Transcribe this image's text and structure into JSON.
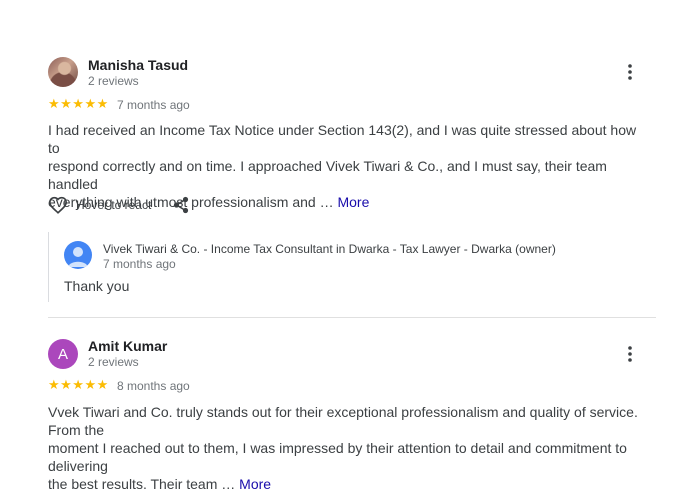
{
  "reviews": [
    {
      "author": "Manisha Tasud",
      "review_count": "2 reviews",
      "avatar": "photo",
      "rating": "★★★★★",
      "date": "7 months ago",
      "text_lines": [
        "I had received an Income Tax Notice under Section 143(2), and I was quite stressed about how to",
        "respond correctly and on time. I approached Vivek Tiwari & Co., and I must say, their team handled",
        "everything with utmost professionalism and … "
      ],
      "more_label": "More",
      "react_label": "Hover to react",
      "reply": {
        "owner": "Vivek Tiwari & Co. - Income Tax Consultant in Dwarka - Tax Lawyer - Dwarka (owner)",
        "date": "7 months ago",
        "text": "Thank you"
      }
    },
    {
      "author": "Amit Kumar",
      "review_count": "2 reviews",
      "avatar_letter": "A",
      "rating": "★★★★★",
      "date": "8 months ago",
      "text_lines": [
        "Vvek Tiwari and Co. truly stands out for their exceptional professionalism and quality of service. From the",
        "moment I reached out to them, I was impressed by their attention to detail and commitment to delivering",
        "the best results. Their team … "
      ],
      "more_label": "More"
    }
  ],
  "colors": {
    "star": "#fbbc04",
    "link": "#1a0dab",
    "avatar_a": "#ab47bc",
    "owner_avatar": "#4285f4"
  },
  "icons": [
    "kebab-menu-icon",
    "heart-outline-icon",
    "share-icon",
    "person-icon"
  ]
}
